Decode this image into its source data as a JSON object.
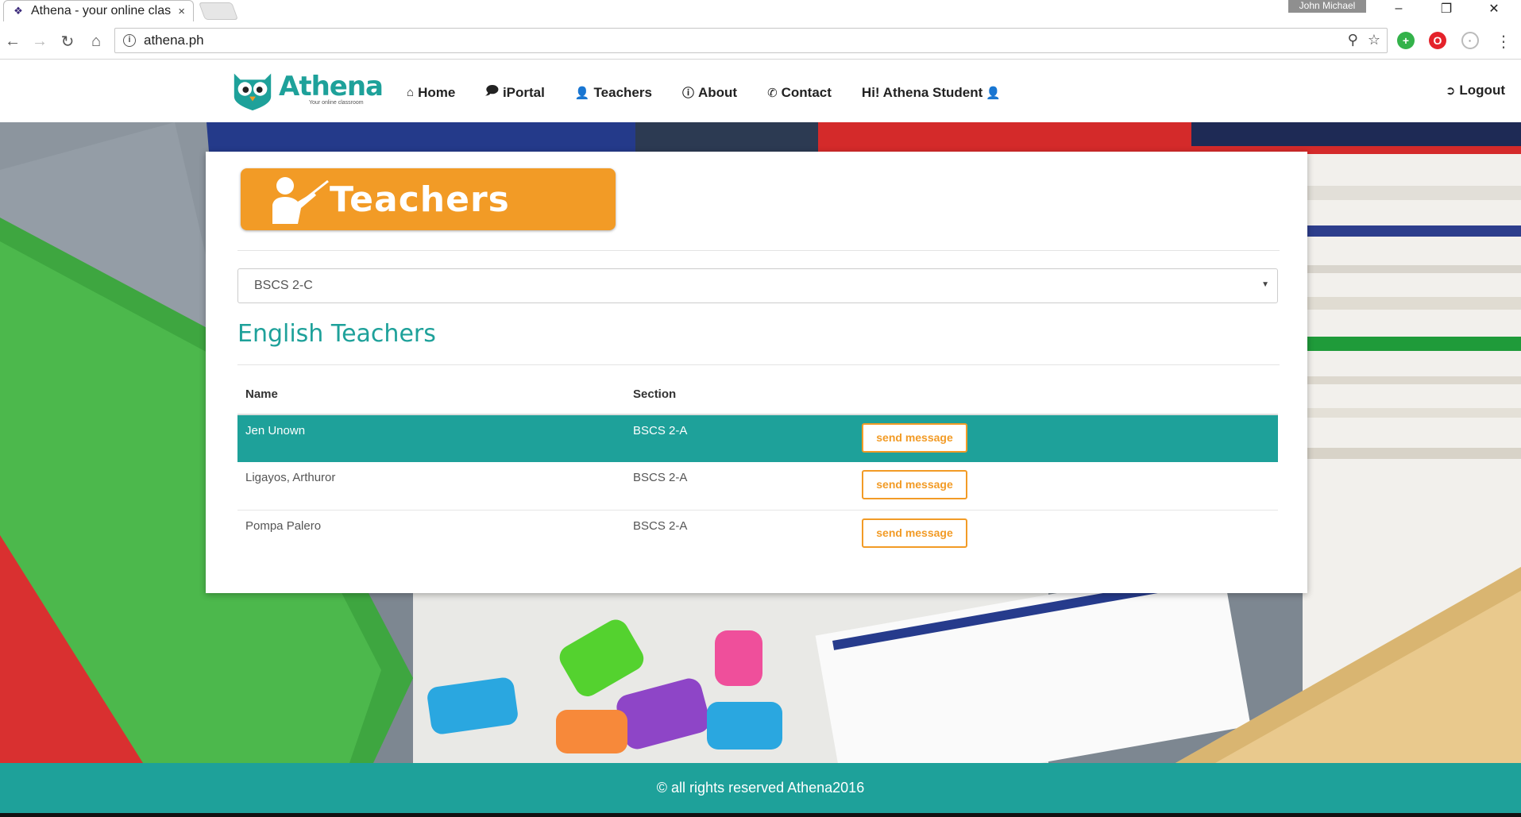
{
  "browser": {
    "tab_title": "Athena - your online clas",
    "tab_close": "×",
    "profile_name": "John Michael",
    "url": "athena.ph"
  },
  "site": {
    "logo_name": "Athena",
    "logo_tagline": "Your online classroom",
    "nav": [
      {
        "icon": "home-icon",
        "label": "Home"
      },
      {
        "icon": "comment-icon",
        "label": "iPortal"
      },
      {
        "icon": "user-icon",
        "label": "Teachers"
      },
      {
        "icon": "info-icon",
        "label": "About"
      },
      {
        "icon": "phone-icon",
        "label": "Contact"
      }
    ],
    "greeting": "Hi! Athena Student",
    "logout_label": "Logout"
  },
  "page": {
    "banner_title": "Teachers",
    "section_select_value": "BSCS 2-C",
    "section_title": "English Teachers",
    "table": {
      "headers": [
        "Name",
        "Section"
      ],
      "rows": [
        {
          "name": "Jen Unown",
          "section": "BSCS 2-A",
          "action": "send message",
          "highlighted": true
        },
        {
          "name": "Ligayos, Arthuror",
          "section": "BSCS 2-A",
          "action": "send message",
          "highlighted": false
        },
        {
          "name": "Pompa Palero",
          "section": "BSCS 2-A",
          "action": "send message",
          "highlighted": false
        }
      ]
    }
  },
  "footer": {
    "text": "© all rights reserved Athena2016"
  },
  "colors": {
    "teal": "#1ea19a",
    "orange": "#f29b26"
  }
}
